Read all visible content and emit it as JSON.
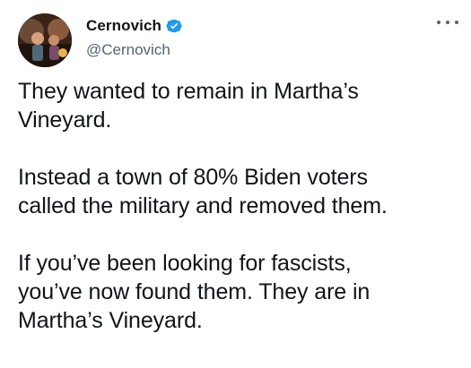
{
  "author": {
    "display_name": "Cernovich",
    "handle": "@Cernovich",
    "verified": true,
    "verified_color": "#1d9bf0"
  },
  "icons": {
    "verified": "verified-badge-icon",
    "more": "more-options-icon"
  },
  "tweet": {
    "paragraphs": [
      "They wanted to remain in Martha’s\nVineyard.",
      "Instead a town of 80% Biden voters\ncalled the military and removed them.",
      "If you’ve been looking for fascists,\nyou’ve now found them. They are in\nMartha’s Vineyard."
    ]
  }
}
